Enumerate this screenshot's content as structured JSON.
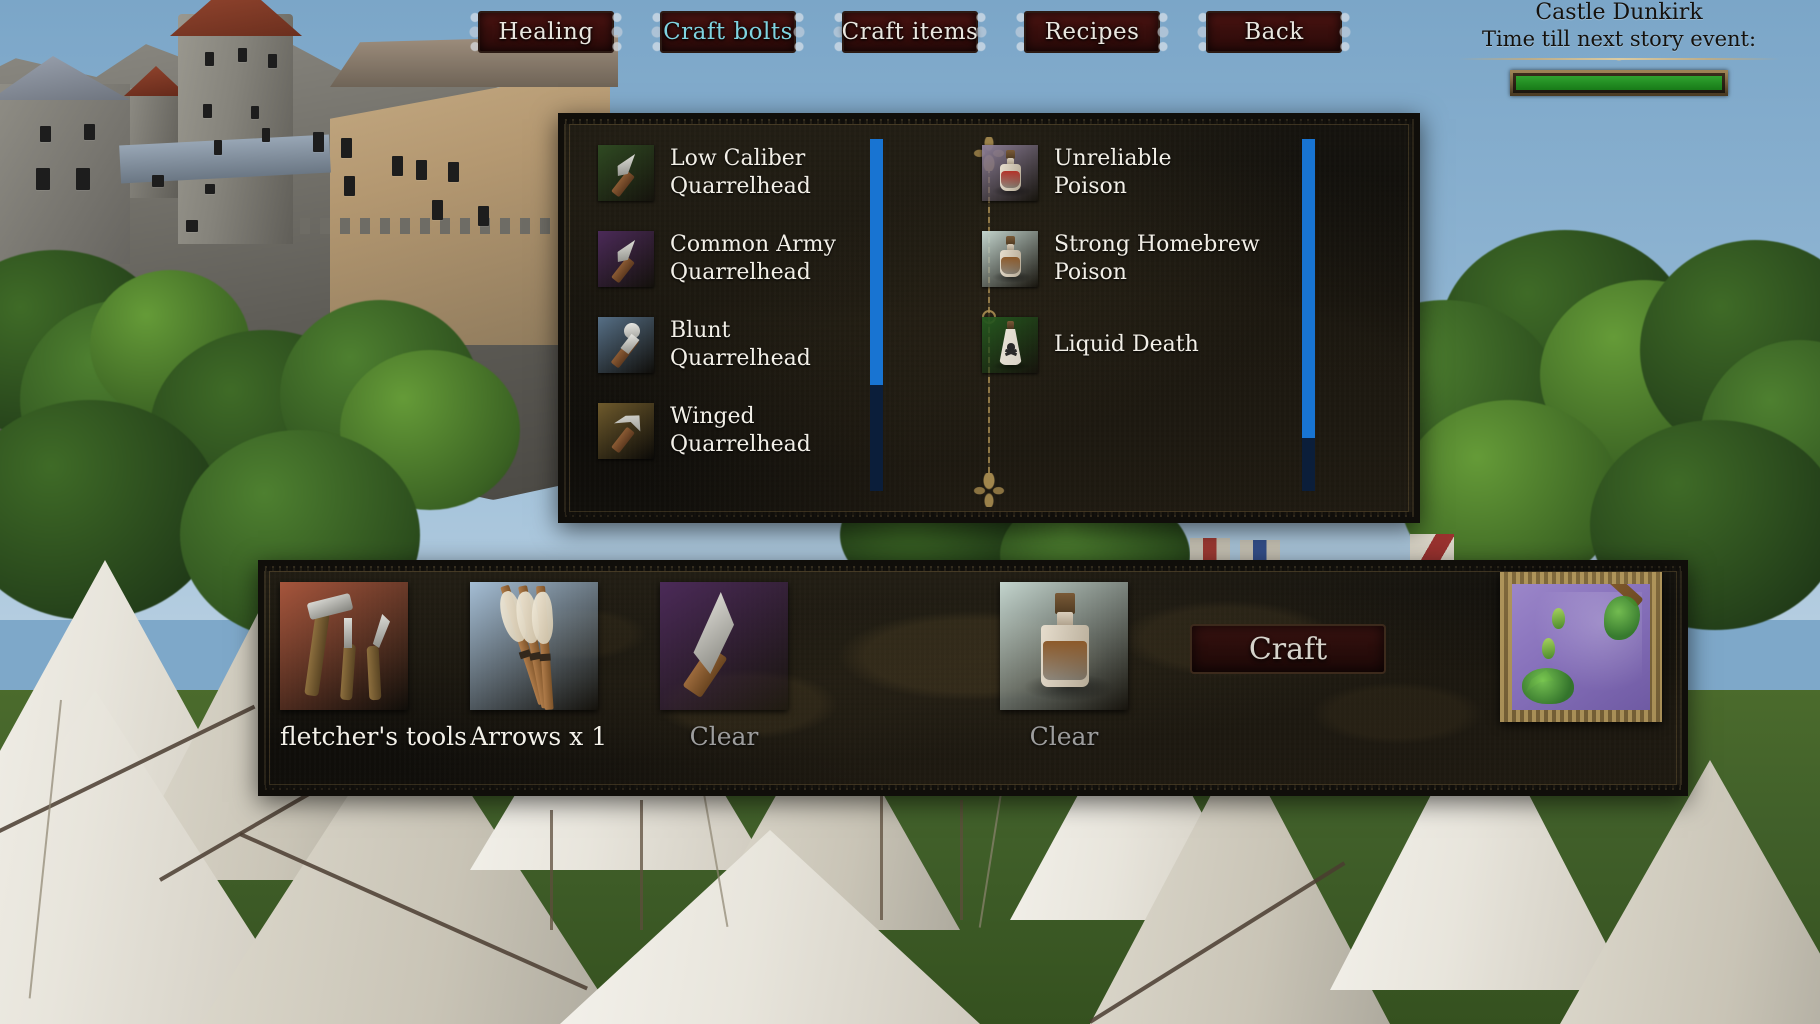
{
  "scene": {
    "description": "Medieval castle on hill above a camp of white tents",
    "sky_color": "#8db3d1",
    "grass_color": "#41602a"
  },
  "topnav": {
    "buttons": [
      {
        "label": "Healing",
        "name": "healing",
        "active": false
      },
      {
        "label": "Craft bolts",
        "name": "craft-bolts",
        "active": true
      },
      {
        "label": "Craft items",
        "name": "craft-items",
        "active": false
      },
      {
        "label": "Recipes",
        "name": "recipes",
        "active": false
      },
      {
        "label": "Back",
        "name": "back",
        "active": false
      }
    ],
    "active_color": "#7fd3e0",
    "idle_color": "#e9e6df"
  },
  "status": {
    "location": "Castle Dunkirk",
    "event_label": "Time till next story event:",
    "progress_percent": 100,
    "progress_color": "#2fa32f"
  },
  "list_panel": {
    "left_column": {
      "scrollbar": {
        "thumb_percent": 70,
        "track_color": "#0b1e3a",
        "thumb_color": "#1874d2"
      },
      "items": [
        {
          "name": "Low Caliber Quarrelhead",
          "line1": "Low Caliber",
          "line2": "Quarrelhead",
          "bg": "#2f4a22",
          "tip": "steel",
          "clipped": false
        },
        {
          "name": "Common Army Quarrelhead",
          "line1": "Common Army",
          "line2": "Quarrelhead",
          "bg": "#4b2a58",
          "tip": "steel",
          "clipped": false
        },
        {
          "name": "Blunt Quarrelhead",
          "line1": "Blunt",
          "line2": "Quarrelhead",
          "bg": "#566f86",
          "tip": "blunt",
          "clipped": false
        },
        {
          "name": "Winged Quarrelhead",
          "line1": "Winged",
          "line2": "Quarrelhead",
          "bg": "#6e5a2c",
          "tip": "winged",
          "clipped": true
        }
      ]
    },
    "right_column": {
      "scrollbar": {
        "thumb_percent": 85,
        "track_color": "#0b1e3a",
        "thumb_color": "#1874d2"
      },
      "items": [
        {
          "name": "Unreliable Poison",
          "line1": "Unreliable",
          "line2": "Poison",
          "bg": "#8c7e96",
          "liquid": "#b3332a",
          "clipped": false
        },
        {
          "name": "Strong Homebrew Poison",
          "line1": "Strong Homebrew",
          "line2": "Poison",
          "bg": "#c3d4cd",
          "liquid": "#8d5a2a",
          "clipped": false
        },
        {
          "name": "Liquid Death",
          "line1": "Liquid Death",
          "line2": "",
          "bg": "#25581f",
          "liquid": "#d8d2c6",
          "clipped": true
        }
      ]
    }
  },
  "craft_bar": {
    "slots": [
      {
        "label": "fletcher's tools",
        "name": "fletchers-tools",
        "is_clear": false,
        "bg": "#a6553c",
        "art": "tools"
      },
      {
        "label": "Arrows x 1",
        "name": "arrows",
        "is_clear": false,
        "bg": "#a4bdd4",
        "art": "arrows"
      },
      {
        "label": "Clear",
        "name": "quarrelhead-slot",
        "is_clear": true,
        "bg": "#4b2a58",
        "art": "head"
      },
      {
        "label": "Clear",
        "name": "poison-slot",
        "is_clear": true,
        "bg": "#c3d4cd",
        "art": "potion"
      }
    ],
    "craft_button": "Craft",
    "result": {
      "name": "poisoned-bolt-preview",
      "bg": "#8771bb"
    }
  }
}
